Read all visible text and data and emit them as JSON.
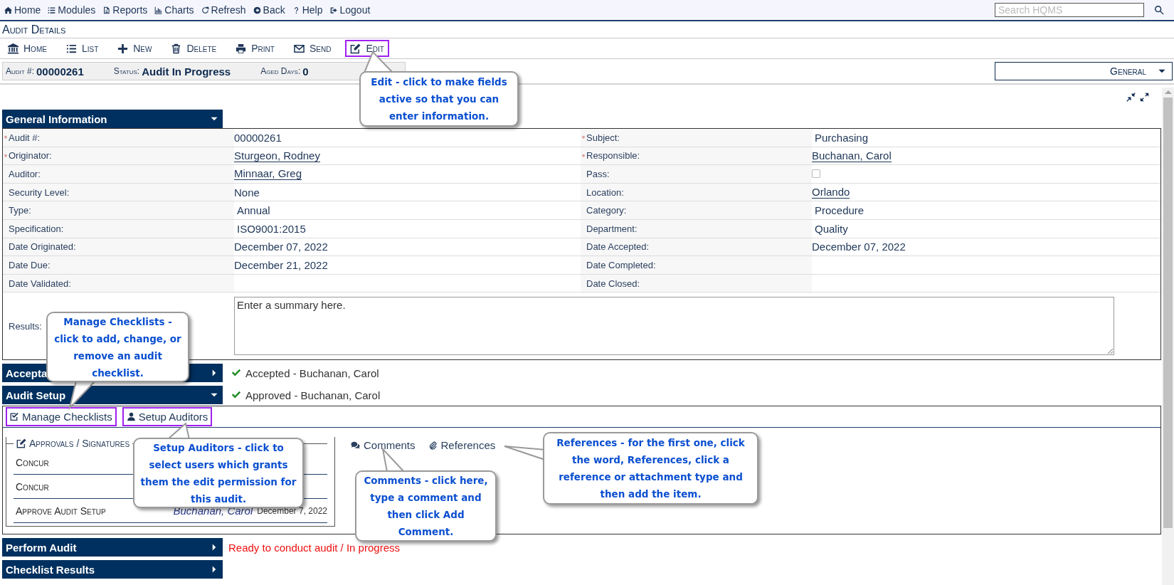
{
  "nav": [
    "Home",
    "Modules",
    "Reports",
    "Charts",
    "Refresh",
    "Back",
    "Help",
    "Logout"
  ],
  "search": {
    "placeholder": "Search HQMS"
  },
  "page_title": "Audit Details",
  "toolbar": [
    {
      "label": "Home",
      "highlighted": false
    },
    {
      "label": "List",
      "highlighted": false
    },
    {
      "label": "New",
      "highlighted": false
    },
    {
      "label": "Delete",
      "highlighted": false
    },
    {
      "label": "Print",
      "highlighted": false
    },
    {
      "label": "Send",
      "highlighted": false
    },
    {
      "label": "Edit",
      "highlighted": true
    }
  ],
  "info_bar": [
    {
      "label": "Audit #:",
      "value": "00000261"
    },
    {
      "label": "Status:",
      "value": "Audit In Progress"
    },
    {
      "label": "Aged Days:",
      "value": "0"
    }
  ],
  "view_select": {
    "value": "General"
  },
  "general_information": {
    "title": "General Information",
    "expanded": true,
    "rows": [
      [
        {
          "label": "Audit #:",
          "required": true,
          "kind": "text",
          "value": "00000261"
        },
        {
          "label": "Subject:",
          "required": true,
          "kind": "select",
          "value": "Purchasing"
        }
      ],
      [
        {
          "label": "Originator:",
          "required": true,
          "kind": "link",
          "value": "Sturgeon, Rodney"
        },
        {
          "label": "Responsible:",
          "required": true,
          "kind": "link",
          "value": "Buchanan, Carol"
        }
      ],
      [
        {
          "label": "Auditor:",
          "required": false,
          "kind": "link",
          "value": "Minnaar, Greg"
        },
        {
          "label": "Pass:",
          "required": false,
          "kind": "checkbox",
          "checked": false
        }
      ],
      [
        {
          "label": "Security Level:",
          "required": false,
          "kind": "text",
          "value": "None"
        },
        {
          "label": "Location:",
          "required": false,
          "kind": "link",
          "value": "Orlando"
        }
      ],
      [
        {
          "label": "Type:",
          "required": false,
          "kind": "select",
          "value": "Annual"
        },
        {
          "label": "Category:",
          "required": false,
          "kind": "select",
          "value": "Procedure"
        }
      ],
      [
        {
          "label": "Specification:",
          "required": false,
          "kind": "select",
          "value": "ISO9001:2015"
        },
        {
          "label": "Department:",
          "required": false,
          "kind": "select",
          "value": "Quality"
        }
      ],
      [
        {
          "label": "Date Originated:",
          "required": false,
          "kind": "text",
          "value": "December 07, 2022"
        },
        {
          "label": "Date Accepted:",
          "required": false,
          "kind": "text",
          "value": "December 07, 2022"
        }
      ],
      [
        {
          "label": "Date Due:",
          "required": false,
          "kind": "text",
          "value": "December 21, 2022"
        },
        {
          "label": "Date Completed:",
          "required": false,
          "kind": "text"
        }
      ],
      [
        {
          "label": "Date Validated:",
          "required": false,
          "kind": "text"
        },
        {
          "label": "Date Closed:",
          "required": false,
          "kind": "text"
        }
      ]
    ],
    "results": {
      "label": "Results:",
      "value": "Enter a summary here."
    }
  },
  "sections": [
    {
      "title": "Accepta",
      "expanded": false,
      "status": {
        "kind": "done",
        "text": "Accepted - Buchanan, Carol"
      }
    },
    {
      "title": "Audit Setup",
      "expanded": true,
      "status": {
        "kind": "done",
        "text": "Approved - Buchanan, Carol"
      },
      "body": {
        "buttons": [
          {
            "label": "Manage Checklists",
            "highlighted": true
          },
          {
            "label": "Setup Auditors",
            "highlighted": true
          }
        ],
        "approvals": {
          "title": "Approvals / Signatures",
          "rows": [
            {
              "step": "Concur"
            },
            {
              "step": "Concur"
            },
            {
              "step": "Approve Audit Setup",
              "signer": "Buchanan, Carol",
              "date": "December 7, 2022"
            }
          ]
        },
        "links": [
          "Comments",
          "References"
        ]
      }
    },
    {
      "title": "Perform Audit",
      "expanded": false,
      "status": {
        "kind": "alert",
        "text": "Ready to conduct audit / In progress"
      }
    },
    {
      "title": "Checklist Results",
      "expanded": false
    }
  ],
  "callouts": [
    "Edit - click to make fields active so that you can enter information.",
    "Manage Checklists - click to add, change, or remove an audit checklist.",
    "Setup Auditors - click to select users which grants them the edit permission for this audit.",
    "Comments - click here, type a comment and then click Add Comment.",
    "References - for the first one, click the word, References, click a reference or attachment type and then add the item."
  ]
}
